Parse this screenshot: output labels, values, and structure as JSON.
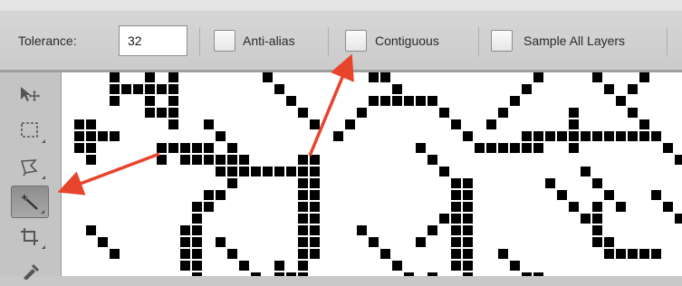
{
  "options_bar": {
    "tolerance_label": "Tolerance:",
    "tolerance_value": "32",
    "anti_alias_label": "Anti-alias",
    "anti_alias_checked": false,
    "contiguous_label": "Contiguous",
    "contiguous_checked": false,
    "sample_all_layers_label": "Sample All Layers",
    "sample_all_layers_checked": false
  },
  "tools": [
    {
      "name": "move-icon",
      "active": false
    },
    {
      "name": "rectangular-marquee-icon",
      "active": false
    },
    {
      "name": "lasso-icon",
      "active": false
    },
    {
      "name": "magic-wand-icon",
      "active": true
    },
    {
      "name": "crop-icon",
      "active": false
    },
    {
      "name": "eyedropper-icon",
      "active": false
    }
  ],
  "colors": {
    "annotation_arrow": "#e8442c",
    "pixel_fill": "#000000",
    "canvas_bg": "#ffffff"
  }
}
